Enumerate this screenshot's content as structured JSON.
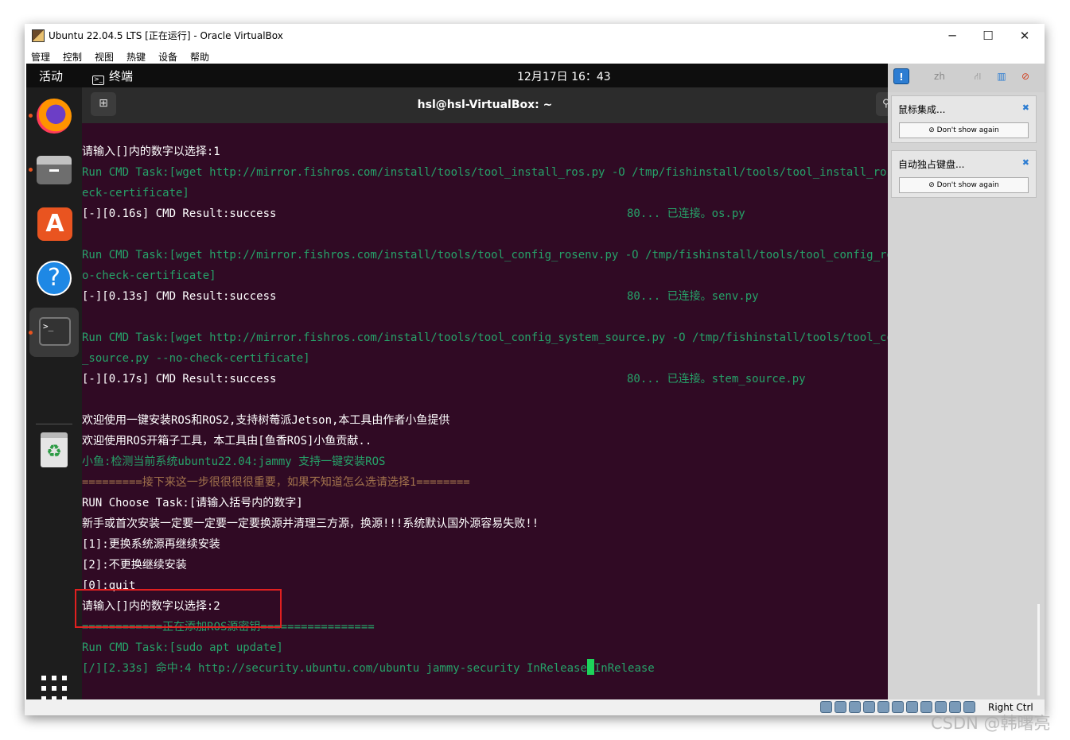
{
  "window": {
    "title": "Ubuntu 22.04.5 LTS [正在运行] - Oracle VirtualBox",
    "minimize": "─",
    "maximize": "☐",
    "close": "✕"
  },
  "menu": [
    "管理",
    "控制",
    "视图",
    "热键",
    "设备",
    "帮助"
  ],
  "ubuntu_topbar": {
    "activities": "活动",
    "app_name": "终端",
    "clock": "12月17日 16：43"
  },
  "terminal": {
    "title": "hsl@hsl-VirtualBox: ~",
    "lines": [
      {
        "text": "请输入[]内的数字以选择:1",
        "color": "white"
      },
      {
        "text": "Run CMD Task:[wget http://mirror.fishros.com/install/tools/tool_install_ros.py -O /tmp/fishinstall/tools/tool_install_ros.py --no-ch",
        "color": "green"
      },
      {
        "text": "eck-certificate]",
        "color": "green"
      },
      {
        "text": "[-][0.16s] CMD Result:success",
        "color": "white",
        "overlay": "80... 已连接。os.py"
      },
      {
        "text": "",
        "color": "white"
      },
      {
        "text": "Run CMD Task:[wget http://mirror.fishros.com/install/tools/tool_config_rosenv.py -O /tmp/fishinstall/tools/tool_config_rosenv.py --n",
        "color": "green"
      },
      {
        "text": "o-check-certificate]",
        "color": "green"
      },
      {
        "text": "[-][0.13s] CMD Result:success",
        "color": "white",
        "overlay": "80... 已连接。senv.py"
      },
      {
        "text": "",
        "color": "white"
      },
      {
        "text": "Run CMD Task:[wget http://mirror.fishros.com/install/tools/tool_config_system_source.py -O /tmp/fishinstall/tools/tool_config_system",
        "color": "green"
      },
      {
        "text": "_source.py --no-check-certificate]",
        "color": "green"
      },
      {
        "text": "[-][0.17s] CMD Result:success",
        "color": "white",
        "overlay": "80... 已连接。stem_source.py"
      },
      {
        "text": "",
        "color": "white"
      },
      {
        "text": "欢迎使用一键安装ROS和ROS2,支持树莓派Jetson,本工具由作者小鱼提供",
        "color": "white"
      },
      {
        "text": "欢迎使用ROS开箱子工具，本工具由[鱼香ROS]小鱼贡献..",
        "color": "white"
      },
      {
        "text": "小鱼:检测当前系统ubuntu22.04:jammy 支持一键安装ROS",
        "color": "green"
      },
      {
        "text": "=========接下来这一步很很很很重要，如果不知道怎么选请选择1========",
        "color": "orange"
      },
      {
        "text": "RUN Choose Task:[请输入括号内的数字]",
        "color": "white"
      },
      {
        "text": "新手或首次安装一定要一定要一定要换源并清理三方源，换源!!!系统默认国外源容易失败!!",
        "color": "white"
      },
      {
        "text": "[1]:更换系统源再继续安装",
        "color": "white"
      },
      {
        "text": "[2]:不更换继续安装",
        "color": "white"
      },
      {
        "text": "[0]:quit",
        "color": "white"
      },
      {
        "text": "请输入[]内的数字以选择:2",
        "color": "white"
      },
      {
        "text": "============正在添加ROS源密钥=================",
        "color": "green"
      },
      {
        "text": "Run CMD Task:[sudo apt update]",
        "color": "green"
      },
      {
        "text": "[/][2.33s] 命中:4 http://security.ubuntu.com/ubuntu jammy-security InRelease",
        "color": "green",
        "after_cursor": "InRelease"
      }
    ]
  },
  "notifications": [
    {
      "title": "鼠标集成...",
      "button": "Don't show again"
    },
    {
      "title": "自动独占键盘...",
      "button": "Don't show again"
    }
  ],
  "notif_toolbar": {
    "lang": "zh"
  },
  "statusbar": {
    "host_key": "Right Ctrl"
  },
  "watermark": "CSDN @韩曙亮",
  "colors": {
    "terminal_bg": "#300a24",
    "green": "#26a269",
    "orange": "#a2734c",
    "highlight": "#e02020",
    "accent": "#e95420"
  }
}
